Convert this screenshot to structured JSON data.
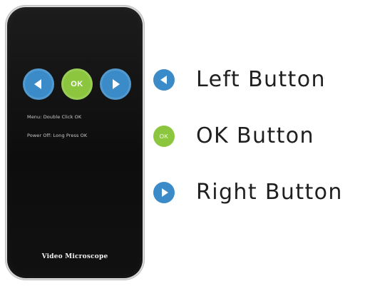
{
  "device": {
    "buttons": {
      "left": {
        "icon": "triangle-left-icon"
      },
      "ok": {
        "label": "OK"
      },
      "right": {
        "icon": "triangle-right-icon"
      }
    },
    "instructions": [
      "Menu: Double Click OK",
      "Power Off: Long Press OK"
    ],
    "footer": "Video Microscope"
  },
  "legend": {
    "items": [
      {
        "label": "Left Button",
        "icon": "triangle-left-icon",
        "color": "#3a8bc8"
      },
      {
        "label": "OK Button",
        "icon_text": "OK",
        "color": "#8cc63f"
      },
      {
        "label": "Right Button",
        "icon": "triangle-right-icon",
        "color": "#3a8bc8"
      }
    ]
  },
  "colors": {
    "blue": "#3a8bc8",
    "green": "#8cc63f",
    "device_body": "#111111",
    "text": "#1f1f1f"
  }
}
